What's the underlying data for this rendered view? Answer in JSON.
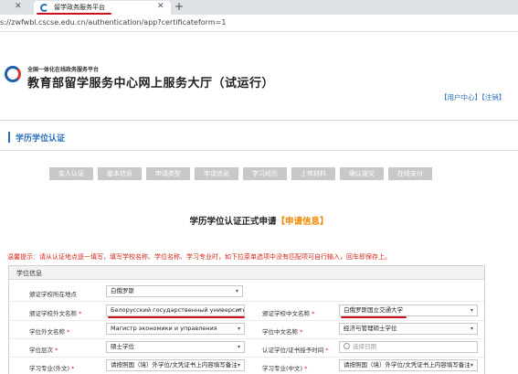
{
  "browser": {
    "tab_title": "留学政务服务平台",
    "url": "s://zwfwbl.cscse.edu.cn/authentication/app?certificateform=1"
  },
  "header": {
    "logo_small": "全国一体化在线政务服务平台",
    "logo_title": "教育部留学服务中心网上服务大厅（试运行）",
    "user_center": "【用户中心】",
    "logout": "【注销】"
  },
  "section": {
    "title": "学历学位认证"
  },
  "steps": [
    "实人认证",
    "基本信息",
    "申请类型",
    "申请信息",
    "学习经历",
    "上传材料",
    "确认提交",
    "在线支付"
  ],
  "form": {
    "heading": "学历学位认证正式申请",
    "heading_accent": "【申请信息】",
    "warning": "温馨提示：请从认证地点逐一填写，填写学校名称、学位名称、学习专业时，如下拉菜单选项中没有匹配项可自行输入，回车即保存上。",
    "panel_title": "学位信息",
    "fields": {
      "country_label": "颁证学校所在地点",
      "country_value": "白俄罗斯",
      "school_foreign_label": "颁证学校外文名称",
      "school_foreign_value": "Белорусский государственный университет...",
      "school_cn_label": "颁证学校中文名称",
      "school_cn_value": "白俄罗斯国立交通大学",
      "degree_foreign_label": "学位外文名称",
      "degree_foreign_value": "Магистр экономики и управления",
      "degree_cn_label": "学位中文名称",
      "degree_cn_value": "经济与管理硕士学位",
      "level_label": "学位层次",
      "level_value": "硕士学位",
      "date_label": "认证学位/证书授予时间",
      "date_placeholder": "选择日期",
      "major_foreign_label": "学习专业(外文)",
      "major_foreign_value": "请按照国（境）外学位/文凭证书上内容填写备注",
      "major_cn_label": "学习专业(中文)",
      "major_cn_value": "请按照国（境）外学位/文凭证书上内容填写备注"
    },
    "required_mark": "*"
  }
}
